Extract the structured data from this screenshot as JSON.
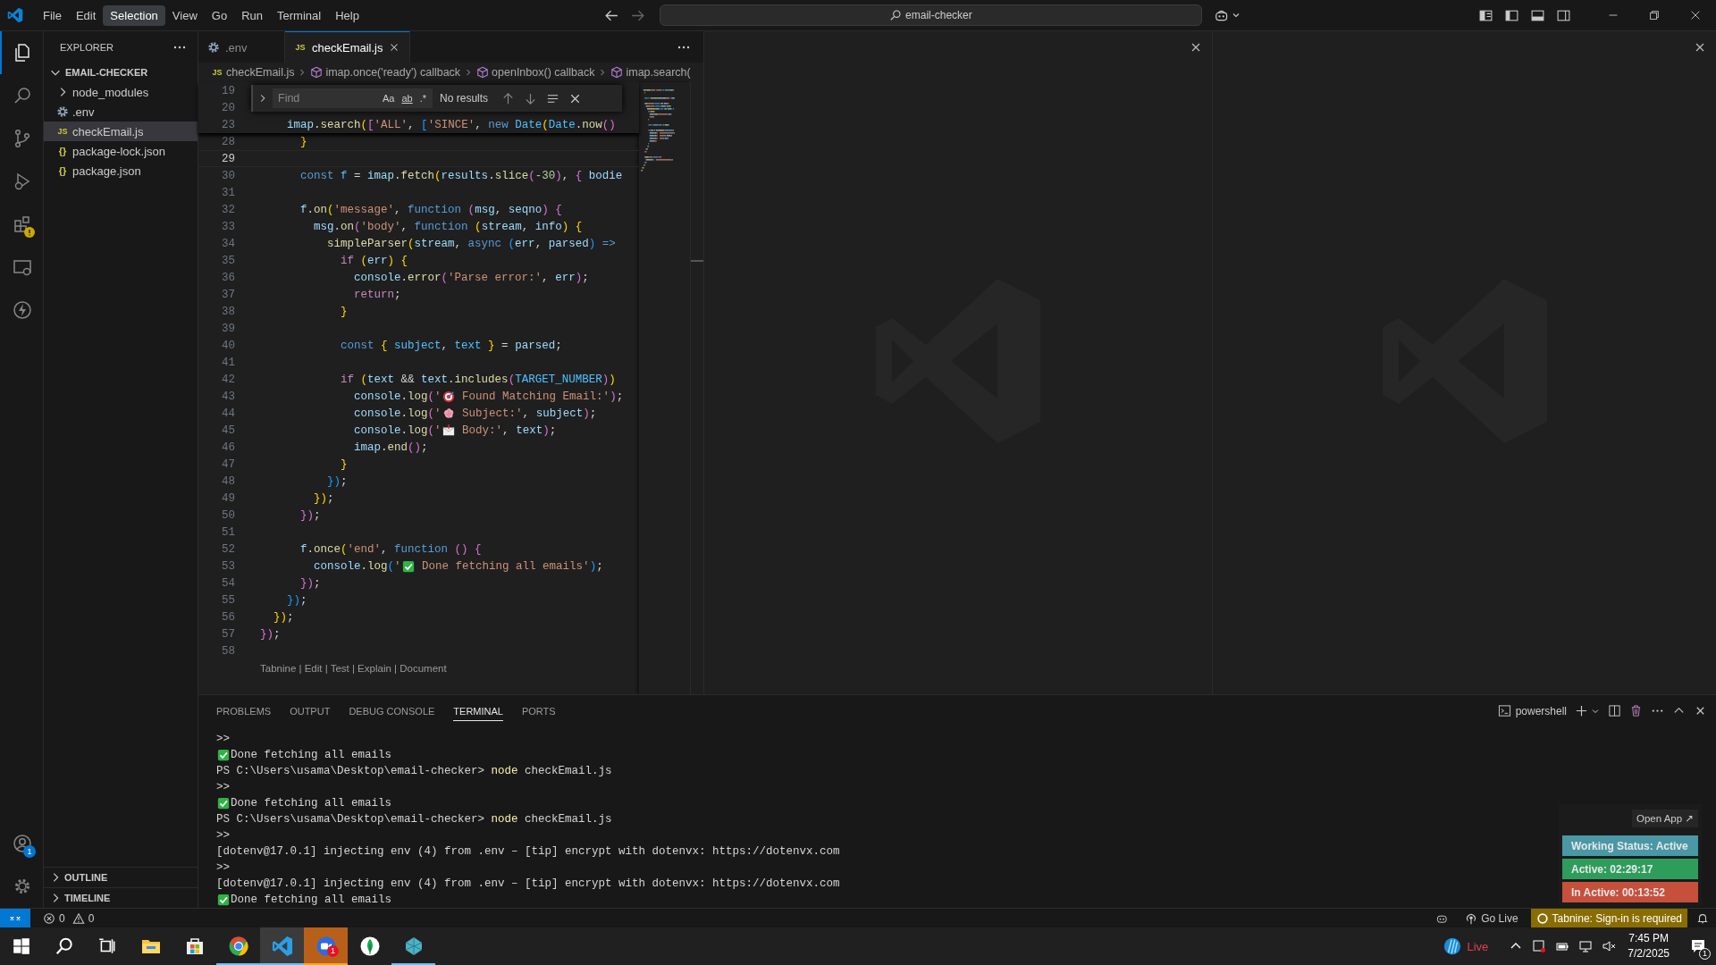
{
  "menu": [
    {
      "label": "File",
      "selected": false
    },
    {
      "label": "Edit",
      "selected": false
    },
    {
      "label": "Selection",
      "selected": true
    },
    {
      "label": "View",
      "selected": false
    },
    {
      "label": "Go",
      "selected": false
    },
    {
      "label": "Run",
      "selected": false
    },
    {
      "label": "Terminal",
      "selected": false
    },
    {
      "label": "Help",
      "selected": false
    }
  ],
  "command_center": {
    "text": "email-checker"
  },
  "activity_bar": [
    {
      "kind": "explorer",
      "selected": true
    },
    {
      "kind": "search",
      "selected": false
    },
    {
      "kind": "source-control",
      "selected": false
    },
    {
      "kind": "run-debug",
      "selected": false
    },
    {
      "kind": "extensions",
      "selected": false,
      "warning": true
    },
    {
      "kind": "remote",
      "selected": false
    },
    {
      "kind": "bolt",
      "selected": false
    }
  ],
  "accounts": {
    "badge": "1"
  },
  "sidebar": {
    "title": "EXPLORER",
    "root": {
      "label": "EMAIL-CHECKER",
      "expanded": true
    },
    "items": [
      {
        "label": "node_modules",
        "kind": "folder",
        "expanded": false,
        "selected": false
      },
      {
        "label": ".env",
        "kind": "gear",
        "selected": false
      },
      {
        "label": "checkEmail.js",
        "kind": "js",
        "glyph": "JS",
        "selected": true
      },
      {
        "label": "package-lock.json",
        "kind": "json",
        "glyph": "{}",
        "selected": false
      },
      {
        "label": "package.json",
        "kind": "json",
        "glyph": "{}",
        "selected": false
      }
    ],
    "sections": [
      {
        "label": "OUTLINE",
        "expanded": false
      },
      {
        "label": "TIMELINE",
        "expanded": false
      }
    ]
  },
  "tabs": [
    {
      "label": ".env",
      "kind": "gear",
      "selected": false
    },
    {
      "label": "checkEmail.js",
      "kind": "js",
      "glyph": "JS",
      "selected": true
    }
  ],
  "breadcrumbs": [
    {
      "label": "checkEmail.js",
      "kind": "js",
      "glyph": "JS"
    },
    {
      "label": "imap.once('ready') callback",
      "kind": "symbol"
    },
    {
      "label": "openInbox() callback",
      "kind": "symbol"
    },
    {
      "label": "imap.search(",
      "kind": "symbol"
    }
  ],
  "find": {
    "placeholder": "Find",
    "toggles": [
      "Aa",
      "ab"
    ],
    "regex": ".*",
    "result": "No results"
  },
  "editor": {
    "sticky": [
      {
        "num": "19"
      },
      {
        "num": "20"
      },
      {
        "num": "23",
        "tokens": [
          {
            "text": "    imap",
            "kind": "variable"
          },
          {
            "text": ".",
            "kind": "plain"
          },
          {
            "text": "search",
            "kind": "function"
          },
          {
            "text": "(",
            "kind": "bracket-a"
          },
          {
            "text": "[",
            "kind": "bracket-b"
          },
          {
            "text": "'ALL'",
            "kind": "string"
          },
          {
            "text": ", ",
            "kind": "plain"
          },
          {
            "text": "[",
            "kind": "bracket-c"
          },
          {
            "text": "'SINCE'",
            "kind": "string"
          },
          {
            "text": ", ",
            "kind": "plain"
          },
          {
            "text": "new ",
            "kind": "keyword"
          },
          {
            "text": "Date",
            "kind": "constant"
          },
          {
            "text": "(",
            "kind": "bracket-a"
          },
          {
            "text": "Date",
            "kind": "constant"
          },
          {
            "text": ".",
            "kind": "plain"
          },
          {
            "text": "now",
            "kind": "function"
          },
          {
            "text": "()",
            "kind": "bracket-b"
          }
        ]
      }
    ],
    "lines": [
      {
        "num": "28",
        "current": false,
        "tokens": [
          {
            "text": "      }",
            "kind": "bracket-a"
          }
        ]
      },
      {
        "num": "29",
        "current": true
      },
      {
        "num": "30",
        "current": false,
        "tokens": [
          {
            "text": "      const ",
            "kind": "keyword"
          },
          {
            "text": "f",
            "kind": "constant"
          },
          {
            "text": " = ",
            "kind": "plain"
          },
          {
            "text": "imap",
            "kind": "variable"
          },
          {
            "text": ".",
            "kind": "plain"
          },
          {
            "text": "fetch",
            "kind": "function"
          },
          {
            "text": "(",
            "kind": "bracket-a"
          },
          {
            "text": "results",
            "kind": "variable"
          },
          {
            "text": ".",
            "kind": "plain"
          },
          {
            "text": "slice",
            "kind": "function"
          },
          {
            "text": "(",
            "kind": "bracket-b"
          },
          {
            "text": "-30",
            "kind": "number"
          },
          {
            "text": ")",
            "kind": "bracket-b"
          },
          {
            "text": ", ",
            "kind": "plain"
          },
          {
            "text": "{ ",
            "kind": "bracket-b"
          },
          {
            "text": "bodie",
            "kind": "variable"
          }
        ]
      },
      {
        "num": "31",
        "current": false
      },
      {
        "num": "32",
        "current": false,
        "tokens": [
          {
            "text": "      f",
            "kind": "variable"
          },
          {
            "text": ".",
            "kind": "plain"
          },
          {
            "text": "on",
            "kind": "function"
          },
          {
            "text": "(",
            "kind": "bracket-a"
          },
          {
            "text": "'message'",
            "kind": "string"
          },
          {
            "text": ", ",
            "kind": "plain"
          },
          {
            "text": "function ",
            "kind": "keyword"
          },
          {
            "text": "(",
            "kind": "bracket-b"
          },
          {
            "text": "msg",
            "kind": "variable"
          },
          {
            "text": ", ",
            "kind": "plain"
          },
          {
            "text": "seqno",
            "kind": "variable"
          },
          {
            "text": ") {",
            "kind": "bracket-b"
          }
        ]
      },
      {
        "num": "33",
        "current": false,
        "tokens": [
          {
            "text": "        msg",
            "kind": "variable"
          },
          {
            "text": ".",
            "kind": "plain"
          },
          {
            "text": "on",
            "kind": "function"
          },
          {
            "text": "(",
            "kind": "bracket-b"
          },
          {
            "text": "'body'",
            "kind": "string"
          },
          {
            "text": ", ",
            "kind": "plain"
          },
          {
            "text": "function ",
            "kind": "keyword"
          },
          {
            "text": "(",
            "kind": "bracket-a"
          },
          {
            "text": "stream",
            "kind": "variable"
          },
          {
            "text": ", ",
            "kind": "plain"
          },
          {
            "text": "info",
            "kind": "variable"
          },
          {
            "text": ") {",
            "kind": "bracket-a"
          }
        ]
      },
      {
        "num": "34",
        "current": false,
        "tokens": [
          {
            "text": "          simpleParser",
            "kind": "function"
          },
          {
            "text": "(",
            "kind": "bracket-a"
          },
          {
            "text": "stream",
            "kind": "variable"
          },
          {
            "text": ", ",
            "kind": "plain"
          },
          {
            "text": "async ",
            "kind": "keyword"
          },
          {
            "text": "(",
            "kind": "bracket-c"
          },
          {
            "text": "err",
            "kind": "variable"
          },
          {
            "text": ", ",
            "kind": "plain"
          },
          {
            "text": "parsed",
            "kind": "variable"
          },
          {
            "text": ")",
            "kind": "bracket-c"
          },
          {
            "text": " =>",
            "kind": "keyword"
          }
        ]
      },
      {
        "num": "35",
        "current": false,
        "tokens": [
          {
            "text": "            if ",
            "kind": "control"
          },
          {
            "text": "(",
            "kind": "bracket-a"
          },
          {
            "text": "err",
            "kind": "variable"
          },
          {
            "text": ") {",
            "kind": "bracket-a"
          }
        ]
      },
      {
        "num": "36",
        "current": false,
        "tokens": [
          {
            "text": "              console",
            "kind": "variable"
          },
          {
            "text": ".",
            "kind": "plain"
          },
          {
            "text": "error",
            "kind": "function"
          },
          {
            "text": "(",
            "kind": "bracket-b"
          },
          {
            "text": "'Parse error:'",
            "kind": "string"
          },
          {
            "text": ", ",
            "kind": "plain"
          },
          {
            "text": "err",
            "kind": "variable"
          },
          {
            "text": ")",
            "kind": "bracket-b"
          },
          {
            "text": ";",
            "kind": "plain"
          }
        ]
      },
      {
        "num": "37",
        "current": false,
        "tokens": [
          {
            "text": "              return",
            "kind": "control"
          },
          {
            "text": ";",
            "kind": "plain"
          }
        ]
      },
      {
        "num": "38",
        "current": false,
        "tokens": [
          {
            "text": "            }",
            "kind": "bracket-a"
          }
        ]
      },
      {
        "num": "39",
        "current": false
      },
      {
        "num": "40",
        "current": false,
        "tokens": [
          {
            "text": "            const ",
            "kind": "keyword"
          },
          {
            "text": "{ ",
            "kind": "bracket-a"
          },
          {
            "text": "subject",
            "kind": "constant"
          },
          {
            "text": ", ",
            "kind": "plain"
          },
          {
            "text": "text",
            "kind": "constant"
          },
          {
            "text": " }",
            "kind": "bracket-a"
          },
          {
            "text": " = ",
            "kind": "plain"
          },
          {
            "text": "parsed",
            "kind": "variable"
          },
          {
            "text": ";",
            "kind": "plain"
          }
        ]
      },
      {
        "num": "41",
        "current": false
      },
      {
        "num": "42",
        "current": false,
        "tokens": [
          {
            "text": "            if ",
            "kind": "control"
          },
          {
            "text": "(",
            "kind": "bracket-a"
          },
          {
            "text": "text",
            "kind": "variable"
          },
          {
            "text": " && ",
            "kind": "plain"
          },
          {
            "text": "text",
            "kind": "variable"
          },
          {
            "text": ".",
            "kind": "plain"
          },
          {
            "text": "includes",
            "kind": "function"
          },
          {
            "text": "(",
            "kind": "bracket-b"
          },
          {
            "text": "TARGET_NUMBER",
            "kind": "constant"
          },
          {
            "text": ")",
            "kind": "bracket-b"
          },
          {
            "text": ")",
            "kind": "bracket-a"
          }
        ]
      },
      {
        "num": "43",
        "current": false,
        "tokens": [
          {
            "text": "              console",
            "kind": "variable"
          },
          {
            "text": ".",
            "kind": "plain"
          },
          {
            "text": "log",
            "kind": "function"
          },
          {
            "text": "(",
            "kind": "bracket-b"
          },
          {
            "text": "'",
            "kind": "string"
          },
          {
            "kind": "target"
          },
          {
            "text": " Found Matching Email:'",
            "kind": "string"
          },
          {
            "text": ")",
            "kind": "bracket-b"
          },
          {
            "text": ";",
            "kind": "plain"
          }
        ]
      },
      {
        "num": "44",
        "current": false,
        "tokens": [
          {
            "text": "              console",
            "kind": "variable"
          },
          {
            "text": ".",
            "kind": "plain"
          },
          {
            "text": "log",
            "kind": "function"
          },
          {
            "text": "(",
            "kind": "bracket-b"
          },
          {
            "text": "'",
            "kind": "string"
          },
          {
            "kind": "brain"
          },
          {
            "text": " Subject:'",
            "kind": "string"
          },
          {
            "text": ", ",
            "kind": "plain"
          },
          {
            "text": "subject",
            "kind": "variable"
          },
          {
            "text": ")",
            "kind": "bracket-b"
          },
          {
            "text": ";",
            "kind": "plain"
          }
        ]
      },
      {
        "num": "45",
        "current": false,
        "tokens": [
          {
            "text": "              console",
            "kind": "variable"
          },
          {
            "text": ".",
            "kind": "plain"
          },
          {
            "text": "log",
            "kind": "function"
          },
          {
            "text": "(",
            "kind": "bracket-b"
          },
          {
            "text": "'",
            "kind": "string"
          },
          {
            "kind": "envelope"
          },
          {
            "text": " Body:'",
            "kind": "string"
          },
          {
            "text": ", ",
            "kind": "plain"
          },
          {
            "text": "text",
            "kind": "variable"
          },
          {
            "text": ")",
            "kind": "bracket-b"
          },
          {
            "text": ";",
            "kind": "plain"
          }
        ]
      },
      {
        "num": "46",
        "current": false,
        "tokens": [
          {
            "text": "              imap",
            "kind": "variable"
          },
          {
            "text": ".",
            "kind": "plain"
          },
          {
            "text": "end",
            "kind": "function"
          },
          {
            "text": "()",
            "kind": "bracket-b"
          },
          {
            "text": ";",
            "kind": "plain"
          }
        ]
      },
      {
        "num": "47",
        "current": false,
        "tokens": [
          {
            "text": "            }",
            "kind": "bracket-a"
          }
        ]
      },
      {
        "num": "48",
        "current": false,
        "tokens": [
          {
            "text": "          })",
            "kind": "bracket-c"
          },
          {
            "text": ";",
            "kind": "plain"
          }
        ]
      },
      {
        "num": "49",
        "current": false,
        "tokens": [
          {
            "text": "        })",
            "kind": "bracket-a"
          },
          {
            "text": ";",
            "kind": "plain"
          }
        ]
      },
      {
        "num": "50",
        "current": false,
        "tokens": [
          {
            "text": "      })",
            "kind": "bracket-b"
          },
          {
            "text": ";",
            "kind": "plain"
          }
        ]
      },
      {
        "num": "51",
        "current": false
      },
      {
        "num": "52",
        "current": false,
        "tokens": [
          {
            "text": "      f",
            "kind": "variable"
          },
          {
            "text": ".",
            "kind": "plain"
          },
          {
            "text": "once",
            "kind": "function"
          },
          {
            "text": "(",
            "kind": "bracket-a"
          },
          {
            "text": "'end'",
            "kind": "string"
          },
          {
            "text": ", ",
            "kind": "plain"
          },
          {
            "text": "function ",
            "kind": "keyword"
          },
          {
            "text": "() {",
            "kind": "bracket-b"
          }
        ]
      },
      {
        "num": "53",
        "current": false,
        "tokens": [
          {
            "text": "        console",
            "kind": "variable"
          },
          {
            "text": ".",
            "kind": "plain"
          },
          {
            "text": "log",
            "kind": "function"
          },
          {
            "text": "(",
            "kind": "bracket-c"
          },
          {
            "text": "'",
            "kind": "string"
          },
          {
            "kind": "check"
          },
          {
            "text": " Done fetching all emails'",
            "kind": "string"
          },
          {
            "text": ")",
            "kind": "bracket-c"
          },
          {
            "text": ";",
            "kind": "plain"
          }
        ]
      },
      {
        "num": "54",
        "current": false,
        "tokens": [
          {
            "text": "      })",
            "kind": "bracket-b"
          },
          {
            "text": ";",
            "kind": "plain"
          }
        ]
      },
      {
        "num": "55",
        "current": false,
        "tokens": [
          {
            "text": "    })",
            "kind": "bracket-c"
          },
          {
            "text": ";",
            "kind": "plain"
          }
        ]
      },
      {
        "num": "56",
        "current": false,
        "tokens": [
          {
            "text": "  })",
            "kind": "bracket-a"
          },
          {
            "text": ";",
            "kind": "plain"
          }
        ]
      },
      {
        "num": "57",
        "current": false,
        "tokens": [
          {
            "text": "})",
            "kind": "bracket-b"
          },
          {
            "text": ";",
            "kind": "plain"
          }
        ]
      },
      {
        "num": "58",
        "current": false
      }
    ],
    "codelens": "Tabnine | Edit | Test | Explain | Document"
  },
  "panel": {
    "tabs": [
      {
        "label": "PROBLEMS",
        "selected": false
      },
      {
        "label": "OUTPUT",
        "selected": false
      },
      {
        "label": "DEBUG CONSOLE",
        "selected": false
      },
      {
        "label": "TERMINAL",
        "selected": true
      },
      {
        "label": "PORTS",
        "selected": false
      }
    ],
    "shell": "powershell",
    "terminal": [
      [
        {
          "text": ">>",
          "kind": "plain"
        }
      ],
      [
        {
          "kind": "check"
        },
        {
          "text": "Done fetching all emails",
          "kind": "plain"
        }
      ],
      [
        {
          "text": "PS C:\\Users\\usama\\Desktop\\email-checker> ",
          "kind": "plain"
        },
        {
          "text": "node",
          "kind": "command"
        },
        {
          "text": " checkEmail.js",
          "kind": "plain"
        }
      ],
      [
        {
          "text": ">>",
          "kind": "plain"
        }
      ],
      [
        {
          "kind": "check"
        },
        {
          "text": "Done fetching all emails",
          "kind": "plain"
        }
      ],
      [
        {
          "text": "PS C:\\Users\\usama\\Desktop\\email-checker> ",
          "kind": "plain"
        },
        {
          "text": "node",
          "kind": "command"
        },
        {
          "text": " checkEmail.js",
          "kind": "plain"
        }
      ],
      [
        {
          "text": ">>",
          "kind": "plain"
        }
      ],
      [
        {
          "text": "[dotenv@17.0.1] injecting env (4) from .env – [tip] encrypt with dotenvx: https://dotenvx.com",
          "kind": "plain"
        }
      ],
      [
        {
          "text": ">>",
          "kind": "plain"
        }
      ],
      [
        {
          "text": "[dotenv@17.0.1] injecting env (4) from .env – [tip] encrypt with dotenvx: https://dotenvx.com",
          "kind": "plain"
        }
      ],
      [
        {
          "kind": "check"
        },
        {
          "text": "Done fetching all emails",
          "kind": "plain"
        }
      ]
    ]
  },
  "tracker": {
    "button": "Open App ↗",
    "rows": [
      {
        "label": "Working Status: Active",
        "color": "#4a97a6"
      },
      {
        "label": "Active: 02:29:17",
        "color": "#2e9d5c"
      },
      {
        "label": "In Active: 00:13:52",
        "color": "#c6503c"
      }
    ]
  },
  "status_bar": {
    "errors": "0",
    "warnings": "0",
    "go_live": "Go Live",
    "tabnine": "Tabnine: Sign-in is required"
  },
  "taskbar": {
    "apps": [
      {
        "kind": "files",
        "running": false,
        "active": false
      },
      {
        "kind": "store",
        "running": false,
        "active": false
      },
      {
        "kind": "chrome",
        "running": true,
        "active": false
      },
      {
        "kind": "vscode",
        "running": true,
        "active": true
      },
      {
        "kind": "zoom",
        "running": true,
        "active": false,
        "badge": "1"
      },
      {
        "kind": "leaf",
        "running": false,
        "active": false
      },
      {
        "kind": "gem",
        "running": true,
        "active": false
      }
    ],
    "weather": "Live",
    "time": "7:45 PM",
    "date": "7/2/2025",
    "notifications": "1"
  }
}
